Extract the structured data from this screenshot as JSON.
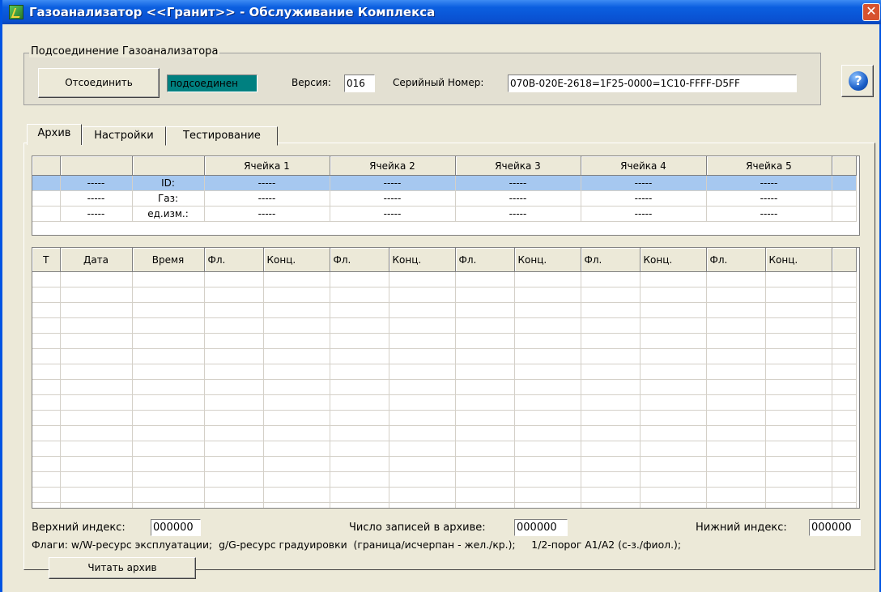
{
  "window": {
    "title": "Газоанализатор <<Гранит>> - Обслуживание Комплекса",
    "close_label": "✕"
  },
  "connection": {
    "group_title": "Подсоединение Газоанализатора",
    "disconnect_label": "Отсоединить",
    "status": "подсоединен",
    "version_label": "Версия:",
    "version_value": "016",
    "serial_label": "Серийный Номер:",
    "serial_value": "070B-020E-2618=1F25-0000=1C10-FFFF-D5FF",
    "help_label": "?"
  },
  "tabs": [
    "Архив",
    "Настройки",
    "Тестирование"
  ],
  "cells_grid": {
    "headers": [
      "",
      "",
      "",
      "Ячейка 1",
      "Ячейка 2",
      "Ячейка 3",
      "Ячейка 4",
      "Ячейка 5",
      ""
    ],
    "rows": [
      [
        "",
        "-----",
        "ID:",
        "-----",
        "-----",
        "-----",
        "-----",
        "-----",
        ""
      ],
      [
        "",
        "-----",
        "Газ:",
        "-----",
        "-----",
        "-----",
        "-----",
        "-----",
        ""
      ],
      [
        "",
        "-----",
        "ед.изм.:",
        "-----",
        "-----",
        "-----",
        "-----",
        "-----",
        ""
      ]
    ]
  },
  "archive_grid": {
    "headers": [
      "T",
      "Дата",
      "Время",
      "Фл.",
      "Конц.",
      "Фл.",
      "Конц.",
      "Фл.",
      "Конц.",
      "Фл.",
      "Конц.",
      "Фл.",
      "Конц.",
      ""
    ]
  },
  "footer": {
    "upper_index_label": "Верхний индекс:",
    "upper_index_value": "000000",
    "records_label": "Число записей в архиве:",
    "records_value": "000000",
    "lower_index_label": "Нижний индекс:",
    "lower_index_value": "000000",
    "flags_text": "Флаги: w/W-ресурс эксплуатации;  g/G-ресурс градуировки  (граница/исчерпан - жел./кр.);     1/2-порог А1/А2 (с-з./фиол.);",
    "read_button": "Читать архив"
  },
  "colors": {
    "title_bar": "#0a50d0",
    "status_bg": "#008080",
    "selected_row": "#a6c8f0",
    "window_bg": "#ece9d8"
  }
}
